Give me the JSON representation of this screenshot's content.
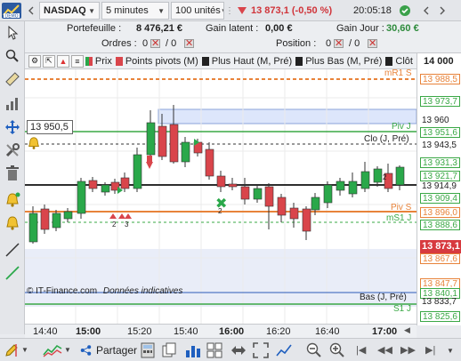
{
  "toolbar": {
    "symbol": "NASDAQ",
    "interval": "5 minutes",
    "units": "100 unités",
    "price_change": "13 873,1 (-0,50 %)",
    "time": "20:05:18"
  },
  "account": {
    "portfolio_label": "Portefeuille :",
    "portfolio_value": "8 476,21 €",
    "latent_label": "Gain latent :",
    "latent_value": "0,00 €",
    "day_label": "Gain Jour :",
    "day_value": "30,60 €",
    "orders_label": "Ordres :",
    "orders_a": "0",
    "orders_b": "/ 0",
    "position_label": "Position :",
    "position_a": "0",
    "position_b": "/ 0"
  },
  "indicators": {
    "prix": "Prix",
    "pivots": "Points pivots (M)",
    "plus_haut": "Plus Haut (M, Pré)",
    "plus_bas": "Plus Bas (M, Pré)",
    "cloture": "Clôt"
  },
  "chart_labels": {
    "crosshair_price": "13 950,5",
    "piv_j": "Piv J",
    "clo": "Clo (J, Pré)",
    "piv_s": "Piv S",
    "ms1": "mS1 J",
    "s1": "S1 J",
    "bas": "Bas (J, Pré)",
    "mr1": "mR1 S",
    "copyright": "© IT-Finance.com",
    "data_note": "Données indicatives",
    "order_marker": "2",
    "ann_2a": "2",
    "ann_3": "3",
    "ann_2b": "2"
  },
  "price_axis": {
    "top": "14 000",
    "p1": "13 988,5",
    "p2": "13 973,7",
    "p3": "13 960",
    "p4": "13 951,6",
    "p5": "13 943,5",
    "p6": "13 931,3",
    "p7": "13 921,7",
    "p8": "13 914,9",
    "p9": "13 909,4",
    "p10": "13 896,0",
    "p11": "13 888,6",
    "p12": "13 873,1",
    "p13": "13 867,6",
    "p14": "13 847,7",
    "p15": "13 840,1",
    "p16": "13 833,7",
    "p17": "13 825,6"
  },
  "time_axis": [
    "14:40",
    "15:00",
    "15:20",
    "15:40",
    "16:00",
    "16:20",
    "16:40",
    "17:00"
  ],
  "bottom": {
    "share_label": "Partager"
  },
  "colors": {
    "up": "#2aa84a",
    "down": "#d9454b",
    "accent": "#1f5fbf",
    "current_price_bg": "#d73a3f"
  }
}
